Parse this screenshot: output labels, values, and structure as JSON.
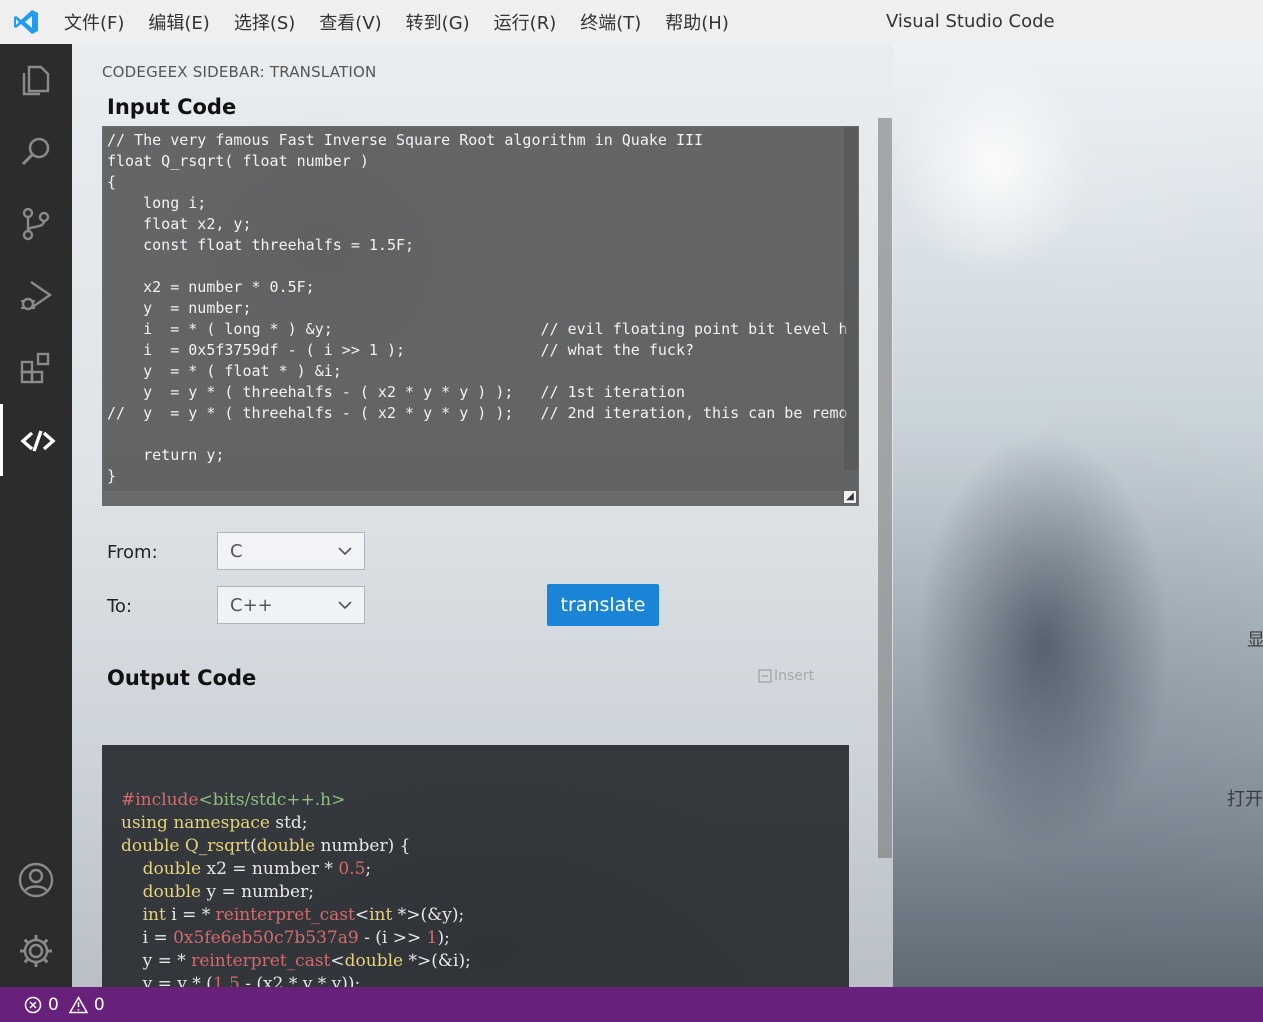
{
  "window": {
    "title": "Visual Studio Code",
    "menu": [
      "文件(F)",
      "编辑(E)",
      "选择(S)",
      "查看(V)",
      "转到(G)",
      "运行(R)",
      "终端(T)",
      "帮助(H)"
    ]
  },
  "activity_bar": {
    "items": [
      {
        "name": "explorer",
        "icon": "files-icon"
      },
      {
        "name": "search",
        "icon": "search-icon"
      },
      {
        "name": "source-control",
        "icon": "source-control-icon"
      },
      {
        "name": "run-debug",
        "icon": "run-debug-icon"
      },
      {
        "name": "extensions",
        "icon": "extensions-icon"
      },
      {
        "name": "codegeex",
        "icon": "codegeex-icon",
        "active": true
      }
    ],
    "bottom": [
      {
        "name": "accounts",
        "icon": "account-icon"
      },
      {
        "name": "manage",
        "icon": "gear-icon"
      }
    ]
  },
  "sidebar": {
    "title": "CODEGEEX SIDEBAR: TRANSLATION",
    "input_heading": "Input Code",
    "input_code": [
      "// The very famous Fast Inverse Square Root algorithm in Quake III",
      "float Q_rsqrt( float number )",
      "{",
      "    long i;",
      "    float x2, y;",
      "    const float threehalfs = 1.5F;",
      "",
      "    x2 = number * 0.5F;",
      "    y  = number;",
      "    i  = * ( long * ) &y;                       // evil floating point bit level h",
      "    i  = 0x5f3759df - ( i >> 1 );               // what the fuck?",
      "    y  = * ( float * ) &i;",
      "    y  = y * ( threehalfs - ( x2 * y * y ) );   // 1st iteration",
      "//  y  = y * ( threehalfs - ( x2 * y * y ) );   // 2nd iteration, this can be remo",
      "",
      "    return y;",
      "}"
    ],
    "from_label": "From:",
    "from_value": "C",
    "to_label": "To:",
    "to_value": "C++",
    "translate_label": "translate",
    "insert_label": "Insert",
    "output_heading": "Output Code"
  },
  "status_bar": {
    "errors": "0",
    "warnings": "0"
  },
  "right_panel": {
    "partial_text_1": "显",
    "partial_text_2": "打开"
  },
  "colors": {
    "status_bar": "#68217a",
    "activity_bar": "#2c2c2c",
    "button": "#1a85d6",
    "vscode_blue": "#1f9cf0"
  }
}
